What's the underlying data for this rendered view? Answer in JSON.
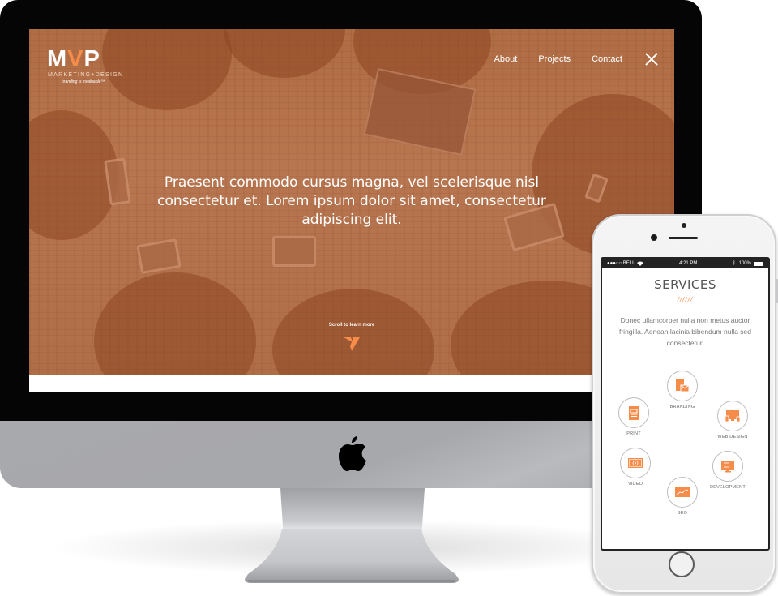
{
  "desktop": {
    "logo": {
      "mark_left": "M",
      "mark_accent": "V",
      "mark_right": "P",
      "subtitle": "MARKETING+DESIGN",
      "tagline": "branding is invaluable™"
    },
    "nav": {
      "items": [
        {
          "label": "About"
        },
        {
          "label": "Projects"
        },
        {
          "label": "Contact"
        }
      ],
      "close_icon": "close-x"
    },
    "hero": {
      "headline": "Praesent commodo cursus magna, vel scelerisque nisl consectetur et. Lorem ipsum dolor sit amet, consectetur adipiscing elit.",
      "scroll_label": "Scroll to learn more"
    },
    "colors": {
      "accent": "#f68c4a",
      "hero_tint": "#b06d44"
    }
  },
  "phone": {
    "status_bar": {
      "carrier": "●●●○○ BELL",
      "time": "4:21 PM",
      "battery": "100%"
    },
    "services": {
      "title": "SERVICES",
      "divider": "//////",
      "description": "Donec ullamcorper nulla non metus auctor fringilla. Aenean lacinia bibendum nulla sed consectetur.",
      "items": [
        {
          "label": "BRANDING",
          "icon": "branding-icon"
        },
        {
          "label": "PRINT",
          "icon": "print-icon"
        },
        {
          "label": "WEB DESIGN",
          "icon": "web-design-icon"
        },
        {
          "label": "VIDEO",
          "icon": "video-icon"
        },
        {
          "label": "DEVELOPMENT",
          "icon": "development-icon"
        },
        {
          "label": "SEO",
          "icon": "seo-icon"
        }
      ]
    }
  }
}
